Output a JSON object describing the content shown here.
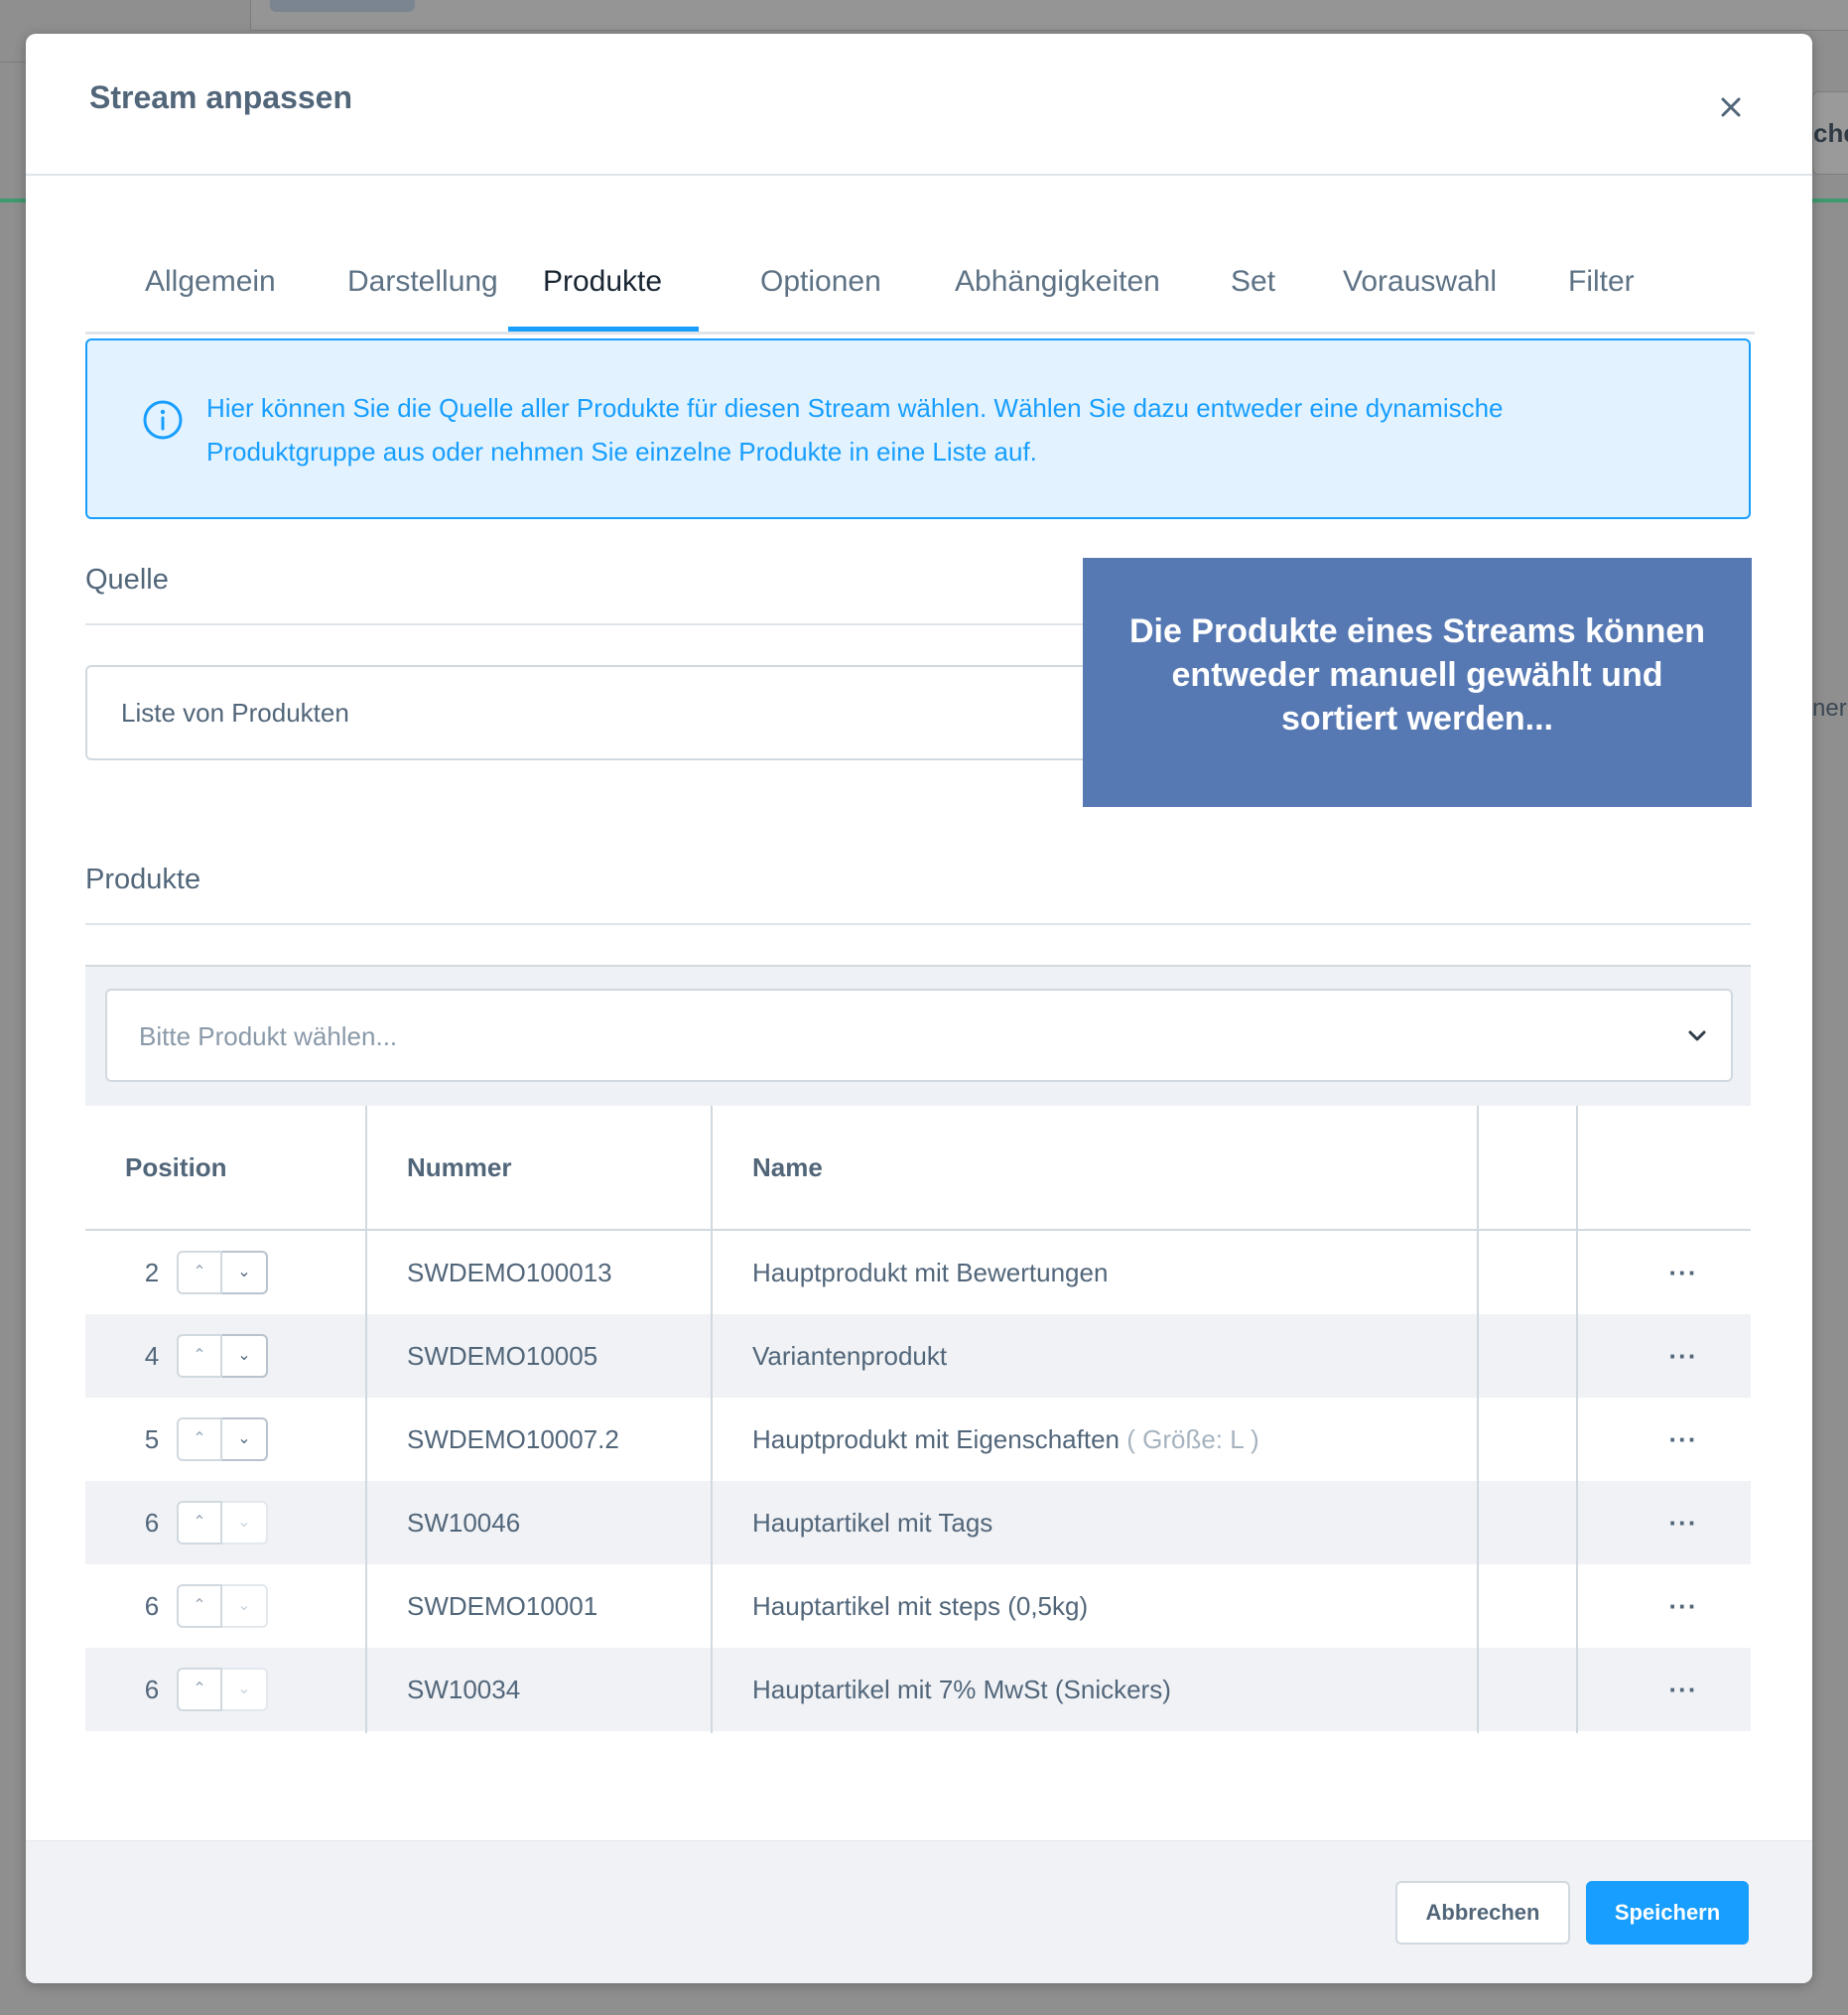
{
  "background": {
    "right_button_fragment": "che",
    "right_text_fragment": "ner"
  },
  "modal": {
    "title": "Stream anpassen"
  },
  "tabs": [
    "Allgemein",
    "Darstellung",
    "Produkte",
    "Optionen",
    "Abhängigkeiten",
    "Set",
    "Vorauswahl",
    "Filter"
  ],
  "active_tab": "Produkte",
  "info": {
    "text": "Hier können Sie die Quelle aller Produkte für diesen Stream wählen. Wählen Sie dazu entweder eine dynamische Produktgruppe aus oder nehmen Sie einzelne Produkte in eine Liste auf."
  },
  "source": {
    "title": "Quelle",
    "value": "Liste von Produkten"
  },
  "callout": {
    "text": "Die Produkte eines Streams können entweder manuell gewählt und sortiert werden..."
  },
  "products": {
    "title": "Produkte",
    "select_placeholder": "Bitte Produkt wählen...",
    "columns": [
      "Position",
      "Nummer",
      "Name"
    ],
    "rows": [
      {
        "position": "2",
        "number": "SWDEMO100013",
        "name": "Hauptprodukt mit Bewertungen",
        "variant": ""
      },
      {
        "position": "4",
        "number": "SWDEMO10005",
        "name": "Variantenprodukt",
        "variant": ""
      },
      {
        "position": "5",
        "number": "SWDEMO10007.2",
        "name": "Hauptprodukt mit Eigenschaften",
        "variant": "( Größe: L )"
      },
      {
        "position": "6",
        "number": "SW10046",
        "name": "Hauptartikel mit Tags",
        "variant": ""
      },
      {
        "position": "6",
        "number": "SWDEMO10001",
        "name": "Hauptartikel mit steps (0,5kg)",
        "variant": ""
      },
      {
        "position": "6",
        "number": "SW10034",
        "name": "Hauptartikel mit 7% MwSt (Snickers)",
        "variant": ""
      }
    ],
    "row_actions_label": "···"
  },
  "footer": {
    "cancel_label": "Abbrechen",
    "save_label": "Speichern"
  },
  "colors": {
    "accent": "#189eff",
    "callout_bg": "#5779b3",
    "info_bg": "#e2f3ff",
    "text": "#52667a"
  }
}
